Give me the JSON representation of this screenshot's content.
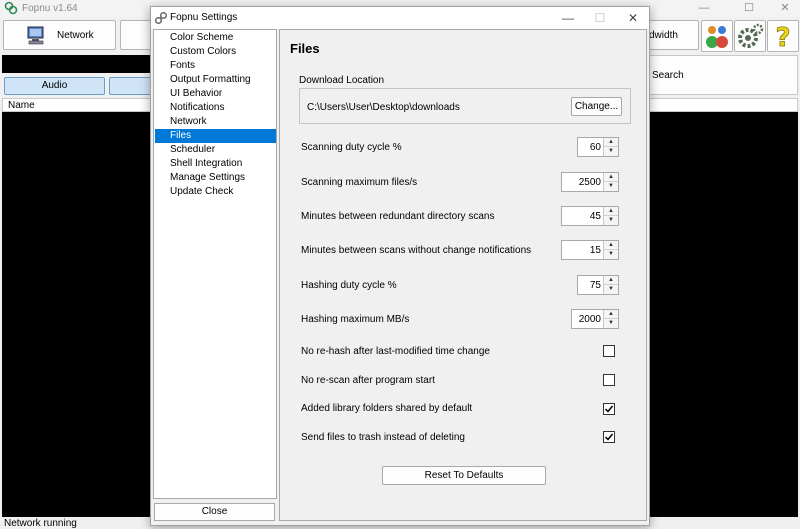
{
  "main_window": {
    "title": "Fopnu v1.64",
    "toolbar": {
      "network_label": "Network",
      "bandwidth_label": "dwidth",
      "search_label": "Search"
    },
    "tabs": {
      "audio_label": "Audio"
    },
    "list": {
      "name_header": "Name"
    },
    "status": "Network running"
  },
  "dialog": {
    "title": "Fopnu Settings",
    "nav_items": [
      "Color Scheme",
      "Custom Colors",
      "Fonts",
      "Output Formatting",
      "UI Behavior",
      "Notifications",
      "Network",
      "Files",
      "Scheduler",
      "Shell Integration",
      "Manage Settings",
      "Update Check"
    ],
    "selected_nav": "Files",
    "close_label": "Close",
    "panel": {
      "title": "Files",
      "download_location_label": "Download Location",
      "download_path": "C:\\Users\\User\\Desktop\\downloads",
      "change_label": "Change...",
      "spin_settings": [
        {
          "label": "Scanning duty cycle %",
          "value": "60"
        },
        {
          "label": "Scanning maximum files/s",
          "value": "2500"
        },
        {
          "label": "Minutes between redundant directory scans",
          "value": "45"
        },
        {
          "label": "Minutes between scans without change notifications",
          "value": "15"
        },
        {
          "label": "Hashing duty cycle %",
          "value": "75"
        },
        {
          "label": "Hashing maximum MB/s",
          "value": "2000"
        }
      ],
      "checkboxes": [
        {
          "label": "No re-hash after last-modified time change",
          "checked": false
        },
        {
          "label": "No re-scan after program start",
          "checked": false
        },
        {
          "label": "Added library folders shared by default",
          "checked": true
        },
        {
          "label": "Send files to trash instead of deleting",
          "checked": true
        }
      ],
      "reset_label": "Reset To Defaults"
    }
  },
  "colors": {
    "selection": "#0078d7",
    "tab_fill": "#cfe4f7",
    "tab_border": "#6d9dc9"
  }
}
